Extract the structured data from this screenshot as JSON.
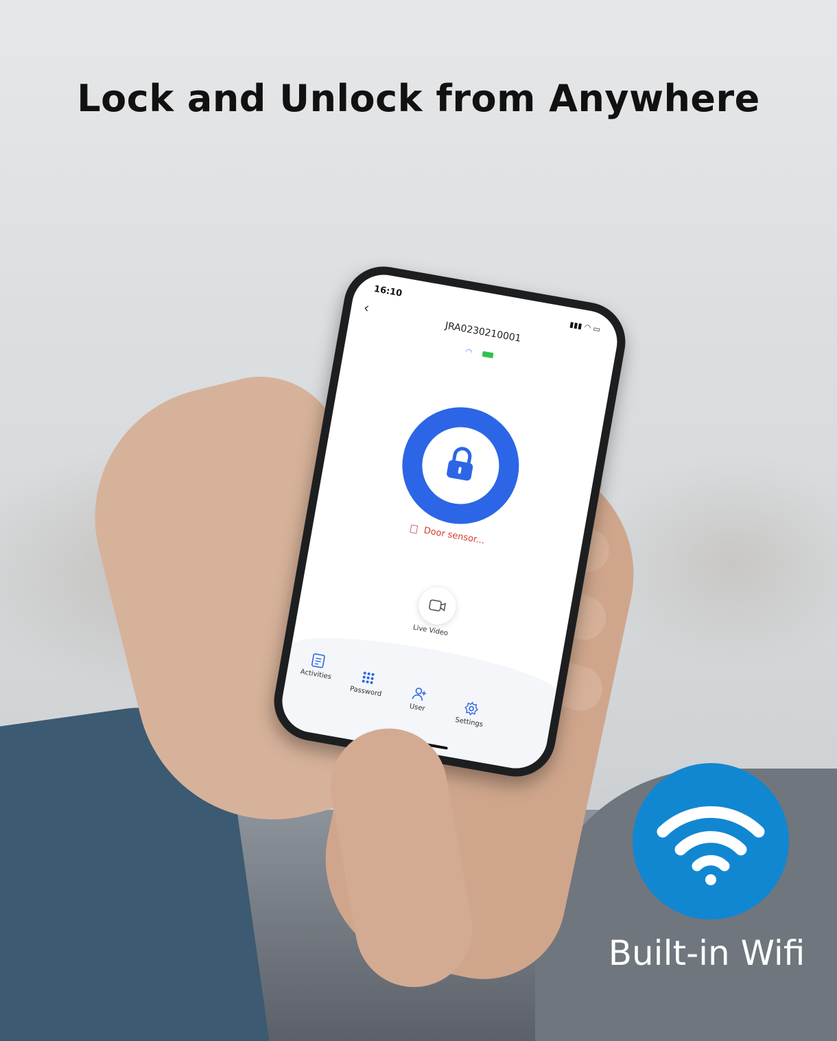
{
  "headline": "Lock and Unlock from Anywhere",
  "badge": {
    "label": "Built-in Wifi",
    "color": "#1187d2"
  },
  "phone": {
    "status_time": "16:10",
    "device_id": "JRA0230210001",
    "door_sensor_text": "Door sensor...",
    "live_video_label": "Live Video",
    "lock_color": "#2c66e6",
    "tabs": [
      {
        "label": "Activities",
        "icon": "list-icon"
      },
      {
        "label": "Password",
        "icon": "keypad-icon"
      },
      {
        "label": "User",
        "icon": "user-add-icon"
      },
      {
        "label": "Settings",
        "icon": "gear-icon"
      }
    ]
  }
}
